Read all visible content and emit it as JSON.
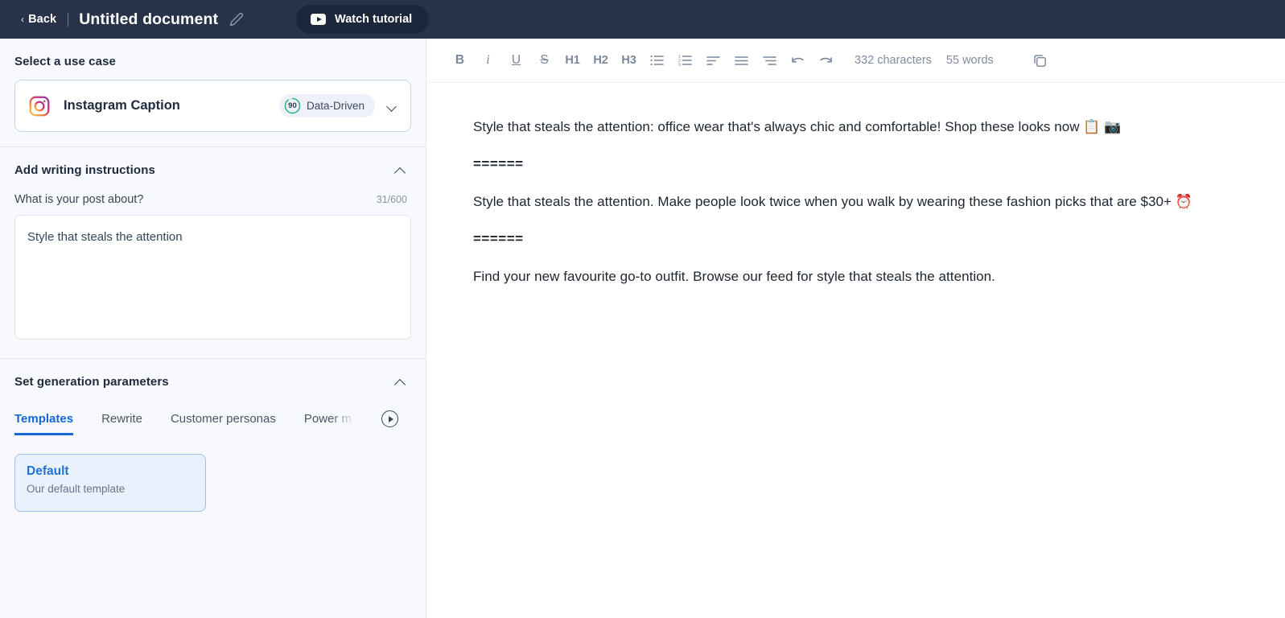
{
  "topbar": {
    "back_label": "Back",
    "back_chevron": "‹",
    "doc_title": "Untitled document",
    "edit_icon": "pencil-icon",
    "watch_tutorial_label": "Watch tutorial",
    "watch_icon": "youtube-play-icon",
    "bg_color": "#28334a"
  },
  "sidebar": {
    "use_case": {
      "section_title": "Select a use case",
      "icon": "instagram-icon",
      "name": "Instagram Caption",
      "badge_score": "90",
      "badge_label": "Data-Driven",
      "badge_ring_color": "#2eb67d",
      "chevron": "chevron-down-icon"
    },
    "instructions": {
      "section_title": "Add writing instructions",
      "collapse_icon": "chevron-up-icon",
      "field_label": "What is your post about?",
      "counter": "31/600",
      "textarea_value": "Style that steals the attention",
      "textarea_placeholder": ""
    },
    "parameters": {
      "section_title": "Set generation parameters",
      "collapse_icon": "chevron-up-icon",
      "tabs": [
        {
          "label": "Templates",
          "active": true
        },
        {
          "label": "Rewrite",
          "active": false
        },
        {
          "label": "Customer personas",
          "active": false
        },
        {
          "label": "Power m",
          "active": false
        }
      ],
      "next_tab_icon": "play-circle-icon",
      "template_card": {
        "name": "Default",
        "description": "Our default template"
      }
    }
  },
  "editor": {
    "toolbar": {
      "bold": "B",
      "italic": "i",
      "underline": "U",
      "strikethrough": "S",
      "h1": "H1",
      "h2": "H2",
      "h3": "H3",
      "bullet_list": "bullet-list-icon",
      "numbered_list": "numbered-list-icon",
      "align_left": "align-left-icon",
      "align_center": "align-center-icon",
      "align_right": "align-right-icon",
      "undo": "undo-icon",
      "redo": "redo-icon",
      "characters": "332 characters",
      "words": "55 words",
      "copy": "copy-icon"
    },
    "content": {
      "paragraph_1": "Style that steals the attention: office wear that's always chic and comfortable! Shop these looks now 📋 📷",
      "separator_1": "======",
      "paragraph_2": "Style that steals the attention. Make people look twice when you walk by wearing these fashion picks that are $30+ ⏰",
      "separator_2": "======",
      "paragraph_3": "Find your new favourite go-to outfit. Browse our feed for style that steals the attention."
    }
  },
  "colors": {
    "accent_blue": "#1668d6",
    "topbar_bg": "#28334a",
    "sidebar_bg": "#f7f9fc",
    "text_dark": "#1d2531"
  }
}
